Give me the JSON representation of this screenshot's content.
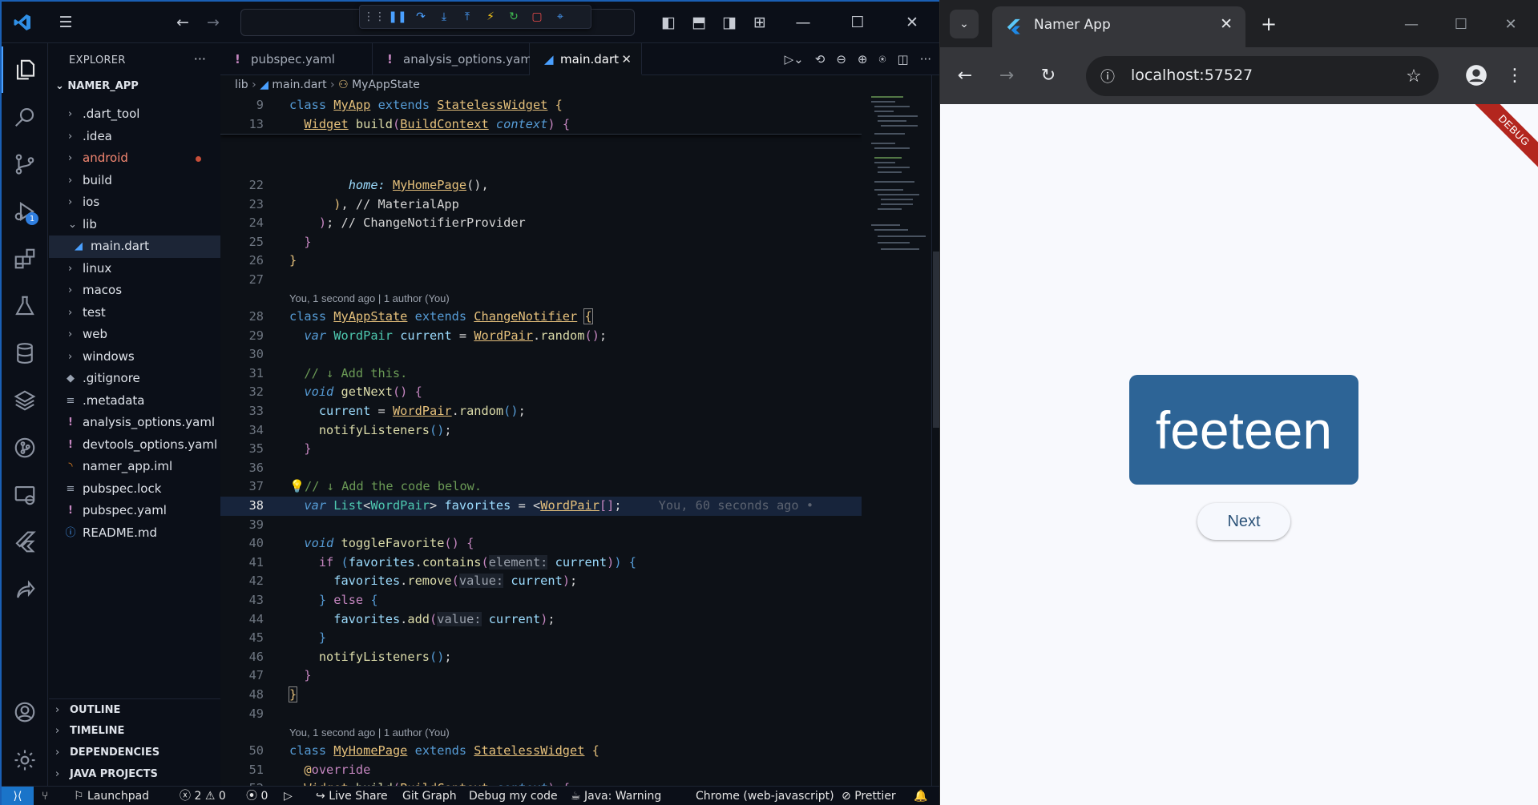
{
  "vscode": {
    "explorer": {
      "header": "EXPLORER",
      "project": "NAMER_APP",
      "items": [
        {
          "label": ".dart_tool",
          "kind": "folder"
        },
        {
          "label": ".idea",
          "kind": "folder"
        },
        {
          "label": "android",
          "kind": "folder",
          "modified": true
        },
        {
          "label": "build",
          "kind": "folder"
        },
        {
          "label": "ios",
          "kind": "folder"
        },
        {
          "label": "lib",
          "kind": "folder-open"
        },
        {
          "label": "main.dart",
          "kind": "file",
          "selected": true
        },
        {
          "label": "linux",
          "kind": "folder"
        },
        {
          "label": "macos",
          "kind": "folder"
        },
        {
          "label": "test",
          "kind": "folder"
        },
        {
          "label": "web",
          "kind": "folder"
        },
        {
          "label": "windows",
          "kind": "folder"
        },
        {
          "label": ".gitignore",
          "kind": "file"
        },
        {
          "label": ".metadata",
          "kind": "file"
        },
        {
          "label": "analysis_options.yaml",
          "kind": "file"
        },
        {
          "label": "devtools_options.yaml",
          "kind": "file"
        },
        {
          "label": "namer_app.iml",
          "kind": "file"
        },
        {
          "label": "pubspec.lock",
          "kind": "file"
        },
        {
          "label": "pubspec.yaml",
          "kind": "file"
        },
        {
          "label": "README.md",
          "kind": "file"
        }
      ],
      "sections": [
        "OUTLINE",
        "TIMELINE",
        "DEPENDENCIES",
        "JAVA PROJECTS"
      ]
    },
    "tabs": [
      {
        "label": "pubspec.yaml"
      },
      {
        "label": "analysis_options.yaml"
      },
      {
        "label": "main.dart",
        "active": true
      }
    ],
    "breadcrumb": {
      "folder": "lib",
      "file": "main.dart",
      "symbol": "MyAppState"
    },
    "codelens": {
      "myappstate": "You, 1 second ago | 1 author (You)",
      "myhomepage": "You, 1 second ago | 1 author (You)"
    },
    "blame": "You, 60 seconds ago •",
    "debug_badge": "1",
    "statusbar": {
      "launchpad": "Launchpad",
      "errors": "2",
      "warnings": "0",
      "ports": "0",
      "live_share": "Live Share",
      "git_graph": "Git Graph",
      "debug_code": "Debug my code",
      "java": "Java: Warning",
      "device": "Chrome (web-javascript)",
      "prettier": "Prettier"
    }
  },
  "browser": {
    "tab_title": "Namer App",
    "url": "localhost:57527",
    "debug_banner": "DEBUG",
    "word": "feeteen",
    "button": "Next",
    "card_color": "#2d6496"
  }
}
